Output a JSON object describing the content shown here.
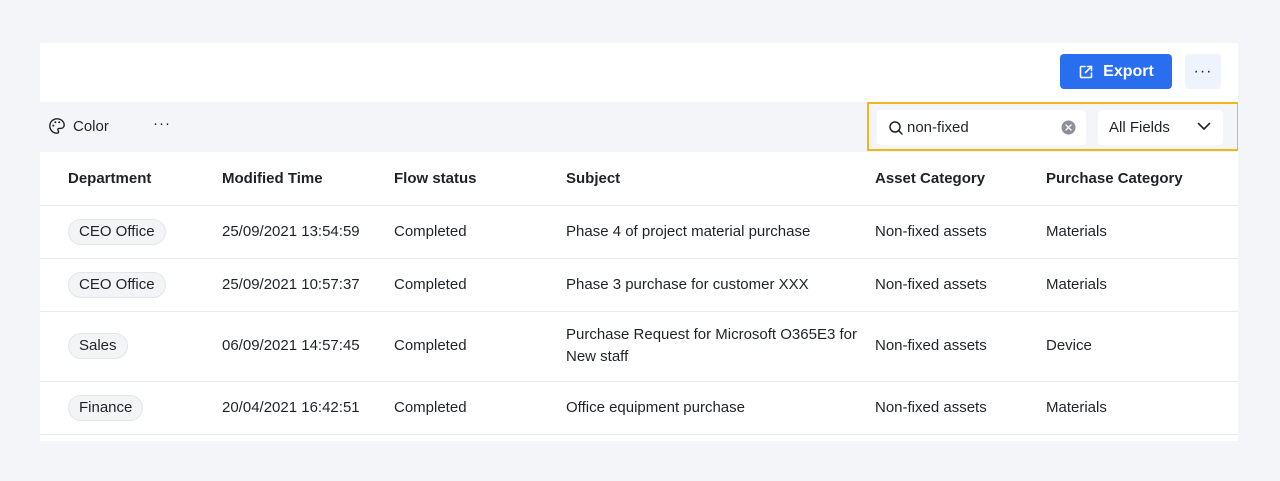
{
  "toolbar": {
    "export_label": "Export",
    "color_label": "Color"
  },
  "search": {
    "value": "non-fixed",
    "field_selected": "All Fields"
  },
  "table": {
    "headers": [
      "Department",
      "Modified Time",
      "Flow status",
      "Subject",
      "Asset Category",
      "Purchase Category"
    ],
    "rows": [
      {
        "department": "CEO Office",
        "modified": "25/09/2021 13:54:59",
        "status": "Completed",
        "subject": "Phase 4 of project material purchase",
        "asset": "Non-fixed assets",
        "purchase": "Materials"
      },
      {
        "department": "CEO Office",
        "modified": "25/09/2021 10:57:37",
        "status": "Completed",
        "subject": "Phase 3 purchase for customer XXX",
        "asset": "Non-fixed assets",
        "purchase": "Materials"
      },
      {
        "department": "Sales",
        "modified": "06/09/2021 14:57:45",
        "status": "Completed",
        "subject": "Purchase Request for Microsoft O365E3 for New staff",
        "asset": "Non-fixed assets",
        "purchase": "Device"
      },
      {
        "department": "Finance",
        "modified": "20/04/2021 16:42:51",
        "status": "Completed",
        "subject": "Office equipment purchase",
        "asset": "Non-fixed assets",
        "purchase": "Materials"
      }
    ]
  },
  "icons": {
    "export": "export-icon",
    "more": "more-horizontal-icon",
    "color": "palette-icon",
    "search": "search-icon",
    "clear": "clear-circle-icon",
    "chevron": "chevron-down-icon"
  },
  "colors": {
    "accent": "#2a6ef0",
    "highlight_border": "#f0b71a",
    "page_bg": "#f4f5f8"
  }
}
